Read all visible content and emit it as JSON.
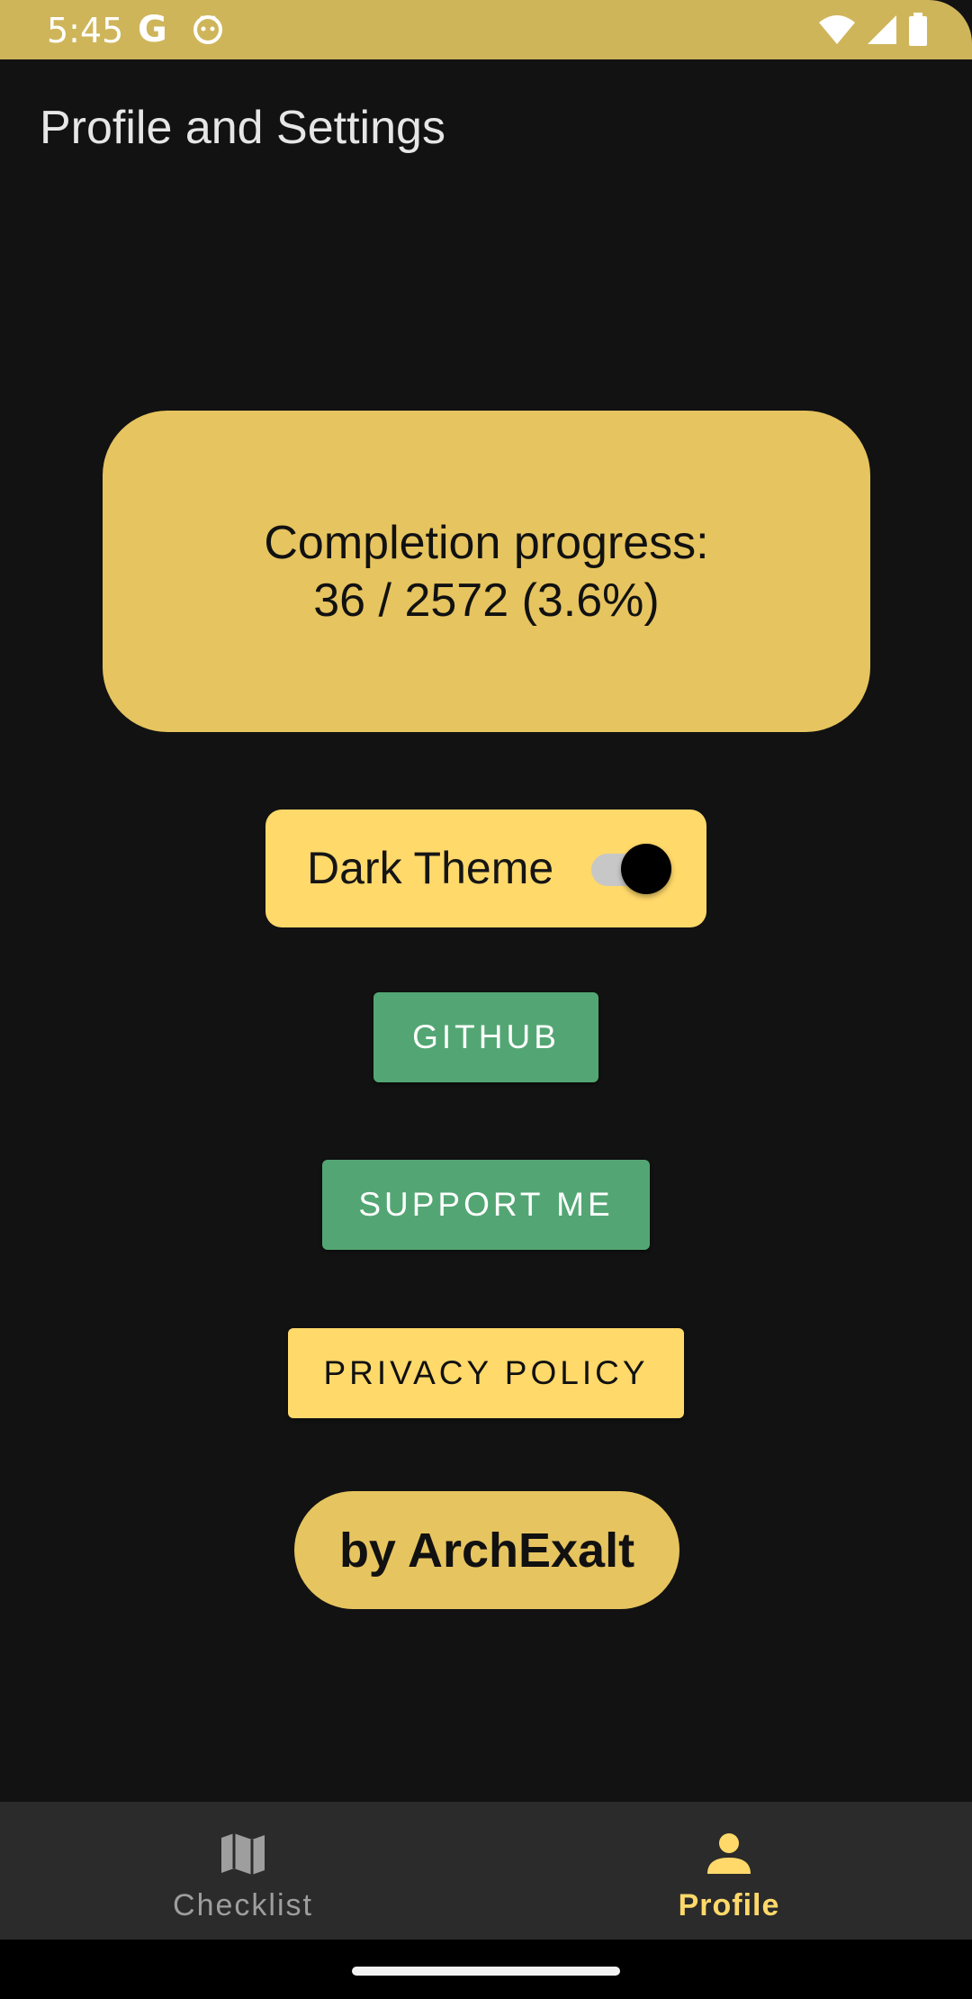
{
  "status_bar": {
    "time": "5:45",
    "g_icon": "G",
    "icons": [
      "google-icon",
      "cat-icon",
      "wifi-icon",
      "signal-icon",
      "battery-icon"
    ]
  },
  "header": {
    "title": "Profile and Settings"
  },
  "progress": {
    "label": "Completion progress:",
    "value": "36 / 2572 (3.6%)"
  },
  "theme": {
    "label": "Dark Theme",
    "enabled": true
  },
  "buttons": {
    "github": "GITHUB",
    "support": "SUPPORT ME",
    "privacy": "PRIVACY POLICY"
  },
  "author": {
    "label": "by ArchExalt"
  },
  "bottom_nav": {
    "items": [
      {
        "label": "Checklist",
        "icon": "map-icon",
        "selected": false
      },
      {
        "label": "Profile",
        "icon": "person-icon",
        "selected": true
      }
    ]
  },
  "colors": {
    "status_bar": "#cfb55a",
    "background": "#121212",
    "card": "#e6c45f",
    "accent_yellow": "#ffd96a",
    "button_green": "#53a673",
    "nav_background": "#2b2b2b"
  }
}
